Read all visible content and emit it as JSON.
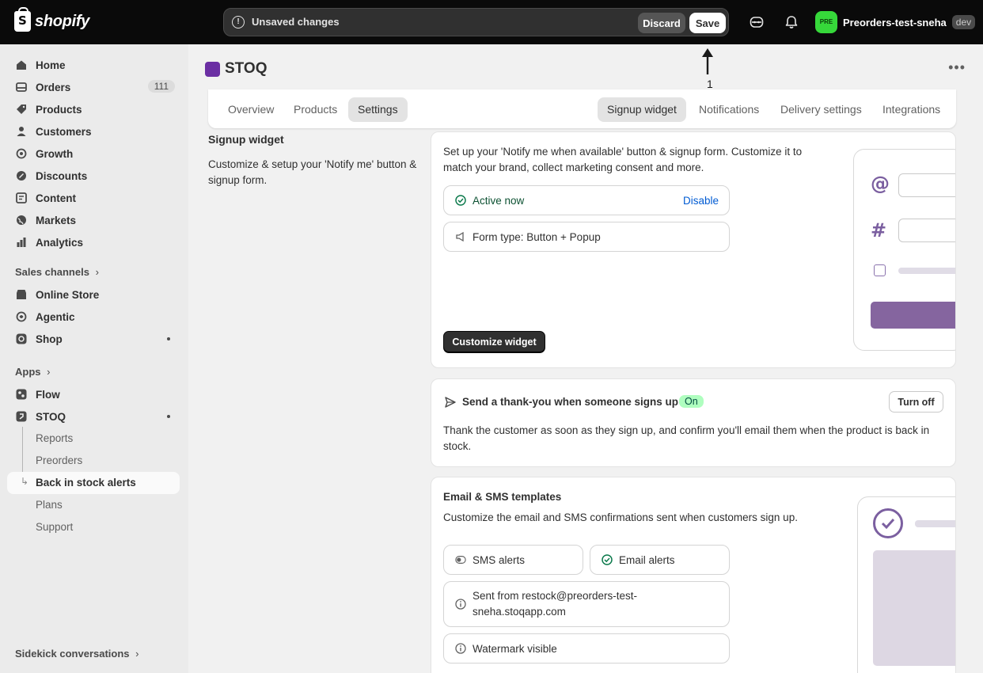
{
  "topbar": {
    "logo_text": "shopify",
    "unsaved_text": "Unsaved changes",
    "discard_label": "Discard",
    "save_label": "Save",
    "store_avatar": "PRE",
    "store_name": "Preorders-test-sneha",
    "store_badge": "dev"
  },
  "sidebar": {
    "items": [
      {
        "label": "Home",
        "icon": "home-icon"
      },
      {
        "label": "Orders",
        "icon": "orders-icon",
        "count": "111"
      },
      {
        "label": "Products",
        "icon": "tag-icon"
      },
      {
        "label": "Customers",
        "icon": "person-icon"
      },
      {
        "label": "Growth",
        "icon": "growth-icon"
      },
      {
        "label": "Discounts",
        "icon": "discount-icon"
      },
      {
        "label": "Content",
        "icon": "content-icon"
      },
      {
        "label": "Markets",
        "icon": "globe-icon"
      },
      {
        "label": "Analytics",
        "icon": "analytics-icon"
      }
    ],
    "sales_channels_label": "Sales channels",
    "channels": [
      {
        "label": "Online Store",
        "icon": "store-icon"
      },
      {
        "label": "Agentic",
        "icon": "agentic-icon"
      },
      {
        "label": "Shop",
        "icon": "shop-icon"
      }
    ],
    "apps_label": "Apps",
    "apps": [
      {
        "label": "Flow",
        "icon": "flow-icon"
      },
      {
        "label": "STOQ",
        "icon": "stoq-icon"
      }
    ],
    "stoq_sub": [
      "Reports",
      "Preorders",
      "Back in stock alerts",
      "Plans",
      "Support"
    ],
    "sidekick_label": "Sidekick conversations"
  },
  "main": {
    "app_name": "STOQ",
    "annotation_number": "1",
    "tabs_left": [
      "Overview",
      "Products",
      "Settings"
    ],
    "tabs_right": [
      "Signup widget",
      "Notifications",
      "Delivery settings",
      "Integrations"
    ],
    "section_title": "Signup widget",
    "section_desc": "Customize & setup your 'Notify me' button & signup form.",
    "card1": {
      "desc": "Set up your 'Notify me when available' button & signup form. Customize it to match your brand, collect marketing consent and more.",
      "status": "Active now",
      "disable_label": "Disable",
      "form_type": "Form type: Button + Popup",
      "customize_label": "Customize widget",
      "preview_at": "@",
      "preview_hash": "#"
    },
    "card2": {
      "title": "Send a thank-you when someone signs up",
      "badge": "On",
      "turn_off_label": "Turn off",
      "desc": "Thank the customer as soon as they sign up, and confirm you'll email them when the product is back in stock."
    },
    "card3": {
      "title": "Email & SMS templates",
      "desc": "Customize the email and SMS confirmations sent when customers sign up.",
      "sms_label": "SMS alerts",
      "email_label": "Email alerts",
      "sent_from": "Sent from restock@preorders-test-sneha.stoqapp.com",
      "watermark": "Watermark visible"
    }
  },
  "colors": {
    "topbar_bg": "#0a0a0a",
    "accent_purple": "#7b5fa0",
    "link_blue": "#005bd3",
    "success_green": "#affebf"
  }
}
